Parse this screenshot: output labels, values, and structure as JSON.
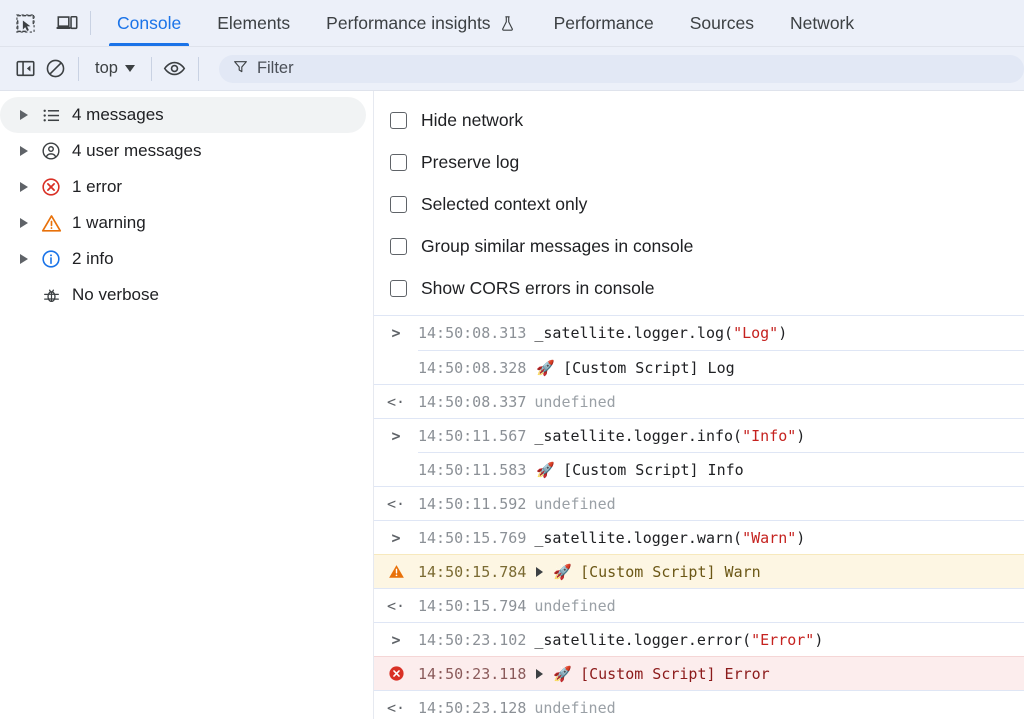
{
  "tabbar": {
    "left_icons": [
      {
        "name": "inspect-element-icon",
        "label": "Inspect element"
      },
      {
        "name": "device-toolbar-icon",
        "label": "Toggle device toolbar"
      }
    ],
    "tabs": [
      {
        "label": "Console",
        "active": true,
        "icon": null
      },
      {
        "label": "Elements",
        "active": false,
        "icon": null
      },
      {
        "label": "Performance insights",
        "active": false,
        "icon": "flask-icon"
      },
      {
        "label": "Performance",
        "active": false,
        "icon": null
      },
      {
        "label": "Sources",
        "active": false,
        "icon": null
      },
      {
        "label": "Network",
        "active": false,
        "icon": null
      }
    ],
    "active_tab_color": "#1a73e8"
  },
  "toolbar": {
    "sidebar_toggle": "show-console-sidebar-icon",
    "clear_console": "clear-console-icon",
    "context_value": "top",
    "eye_icon": "create-live-expression-icon",
    "filter_placeholder": "Filter",
    "filter_value": ""
  },
  "sidebar": {
    "items": [
      {
        "label": "4 messages",
        "icon": "list-icon",
        "expandable": true,
        "selected": true
      },
      {
        "label": "4 user messages",
        "icon": "user-circle-icon",
        "expandable": true,
        "selected": false
      },
      {
        "label": "1 error",
        "icon": "error-circle-icon",
        "expandable": true,
        "selected": false
      },
      {
        "label": "1 warning",
        "icon": "warning-triangle-icon",
        "expandable": true,
        "selected": false
      },
      {
        "label": "2 info",
        "icon": "info-circle-icon",
        "expandable": true,
        "selected": false
      },
      {
        "label": "No verbose",
        "icon": "bug-icon",
        "expandable": false,
        "selected": false
      }
    ]
  },
  "settings": {
    "options": [
      {
        "label": "Hide network",
        "checked": false
      },
      {
        "label": "Preserve log",
        "checked": false
      },
      {
        "label": "Selected context only",
        "checked": false
      },
      {
        "label": "Group similar messages in console",
        "checked": false
      },
      {
        "label": "Show CORS errors in console",
        "checked": false
      }
    ]
  },
  "console": {
    "entries": [
      {
        "kind": "input",
        "gutter": ">",
        "timestamp": "14:50:08.313",
        "code_prefix": "_satellite.logger.log(",
        "string": "\"Log\"",
        "code_suffix": ")"
      },
      {
        "kind": "output",
        "gutter": "",
        "timestamp": "14:50:08.328",
        "rocket": "🚀",
        "text": "[Custom Script] Log",
        "expandable": false
      },
      {
        "kind": "result",
        "gutter": "<·",
        "timestamp": "14:50:08.337",
        "text": "undefined"
      },
      {
        "kind": "input",
        "gutter": ">",
        "timestamp": "14:50:11.567",
        "code_prefix": "_satellite.logger.info(",
        "string": "\"Info\"",
        "code_suffix": ")"
      },
      {
        "kind": "output",
        "gutter": "",
        "timestamp": "14:50:11.583",
        "rocket": "🚀",
        "text": "[Custom Script] Info",
        "expandable": false
      },
      {
        "kind": "result",
        "gutter": "<·",
        "timestamp": "14:50:11.592",
        "text": "undefined"
      },
      {
        "kind": "input",
        "gutter": ">",
        "timestamp": "14:50:15.769",
        "code_prefix": "_satellite.logger.warn(",
        "string": "\"Warn\"",
        "code_suffix": ")"
      },
      {
        "kind": "warning",
        "gutter": "warning-triangle-filled-icon",
        "timestamp": "14:50:15.784",
        "rocket": "🚀",
        "text": "[Custom Script] Warn",
        "expandable": true
      },
      {
        "kind": "result",
        "gutter": "<·",
        "timestamp": "14:50:15.794",
        "text": "undefined"
      },
      {
        "kind": "input",
        "gutter": ">",
        "timestamp": "14:50:23.102",
        "code_prefix": "_satellite.logger.error(",
        "string": "\"Error\"",
        "code_suffix": ")"
      },
      {
        "kind": "error",
        "gutter": "error-circle-filled-icon",
        "timestamp": "14:50:23.118",
        "rocket": "🚀",
        "text": "[Custom Script] Error",
        "expandable": true
      },
      {
        "kind": "result",
        "gutter": "<·",
        "timestamp": "14:50:23.128",
        "text": "undefined"
      }
    ]
  },
  "colors": {
    "accent_blue": "#1a73e8",
    "error_red": "#d93025",
    "warning_orange": "#e8710a",
    "info_blue": "#1a73e8",
    "toolbar_bg": "#ecf0f9",
    "warning_row_bg": "#fdf6e3",
    "error_row_bg": "#fceded",
    "string_literal": "#c5221f"
  }
}
